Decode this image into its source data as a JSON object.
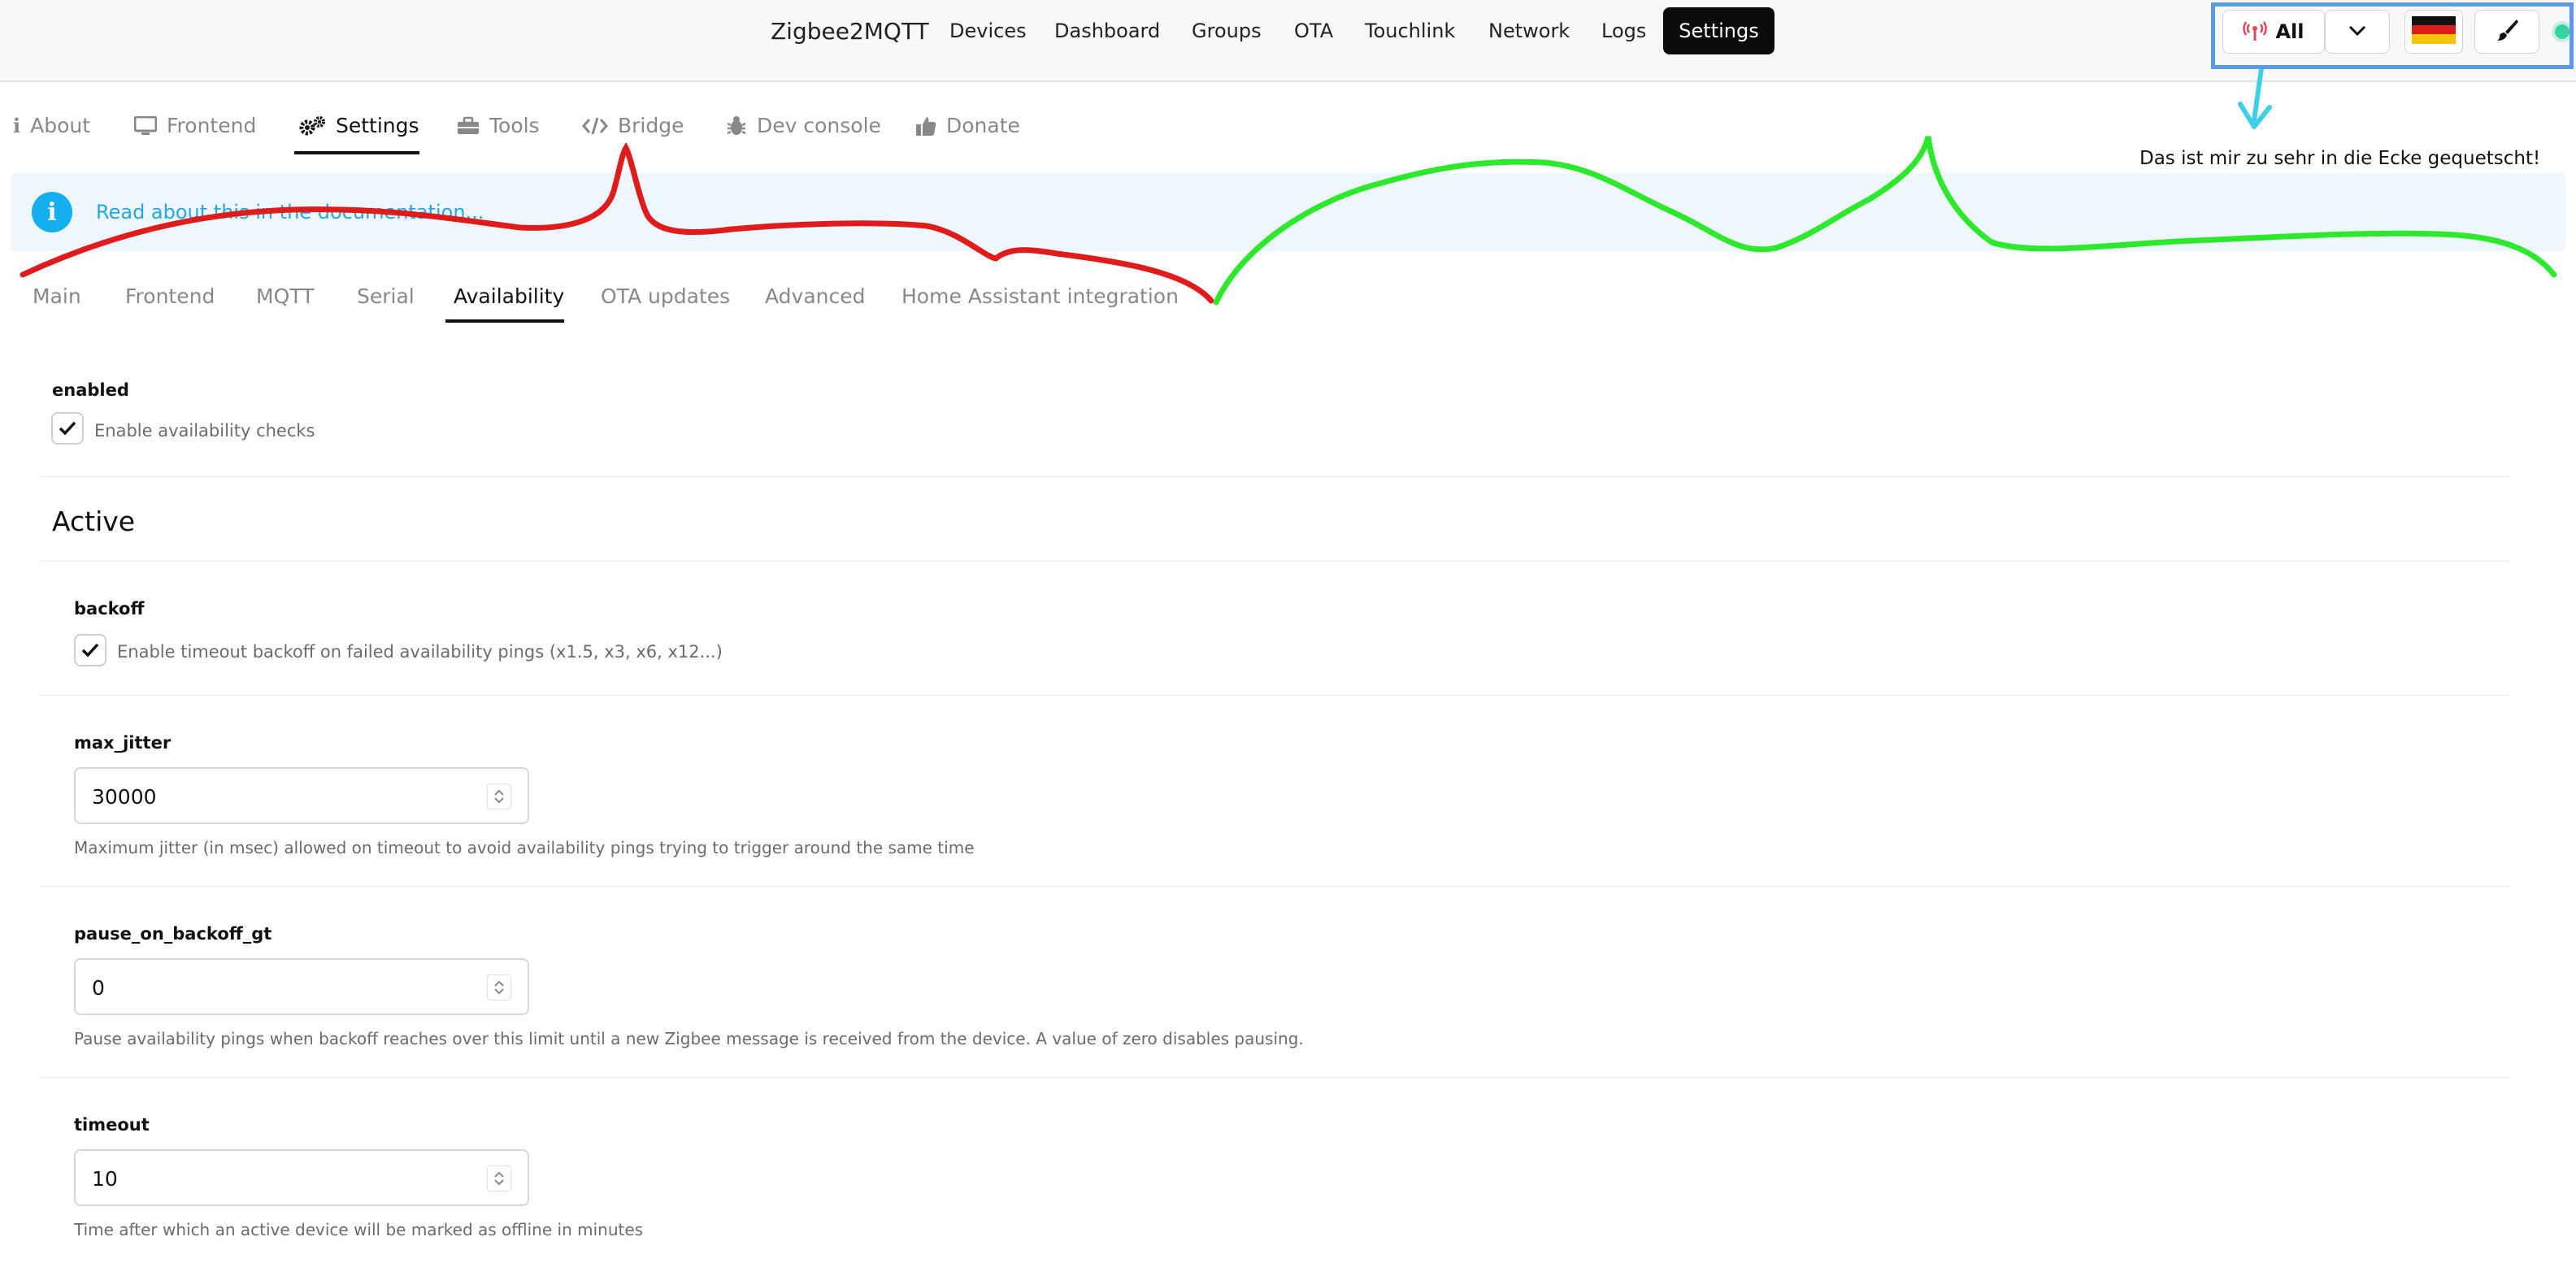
{
  "navbar": {
    "brand": "Zigbee2MQTT",
    "items": [
      "Devices",
      "Dashboard",
      "Groups",
      "OTA",
      "Touchlink",
      "Network",
      "Logs"
    ],
    "active": "Settings",
    "filter_label": "All"
  },
  "settings_tabs": [
    {
      "label": "About",
      "icon": "info-icon"
    },
    {
      "label": "Frontend",
      "icon": "monitor-icon"
    },
    {
      "label": "Settings",
      "icon": "gears-icon"
    },
    {
      "label": "Tools",
      "icon": "toolbox-icon"
    },
    {
      "label": "Bridge",
      "icon": "code-icon"
    },
    {
      "label": "Dev console",
      "icon": "bug-icon"
    },
    {
      "label": "Donate",
      "icon": "thumbs-up-icon"
    }
  ],
  "alert": {
    "icon": "i",
    "link": "Read about this in the documentation..."
  },
  "sub_tabs": [
    "Main",
    "Frontend",
    "MQTT",
    "Serial",
    "Availability",
    "OTA updates",
    "Advanced",
    "Home Assistant integration"
  ],
  "form": {
    "enabled": {
      "label": "enabled",
      "text": "Enable availability checks",
      "checked": true
    },
    "section": "Active",
    "backoff": {
      "label": "backoff",
      "text": "Enable timeout backoff on failed availability pings (x1.5, x3, x6, x12...)",
      "checked": true
    },
    "max_jitter": {
      "label": "max_jitter",
      "value": "30000",
      "help": "Maximum jitter (in msec) allowed on timeout to avoid availability pings trying to trigger around the same time"
    },
    "pause_on_backoff_gt": {
      "label": "pause_on_backoff_gt",
      "value": "0",
      "help": "Pause availability pings when backoff reaches over this limit until a new Zigbee message is received from the device. A value of zero disables pausing."
    },
    "timeout": {
      "label": "timeout",
      "value": "10",
      "help": "Time after which an active device will be marked as offline in minutes"
    }
  },
  "annotation": {
    "text": "Das ist mir zu sehr in die Ecke gequetscht!"
  },
  "colors": {
    "accent": "#0b0b0b",
    "info": "#12aef0",
    "annotation_red": "#e01b1b",
    "annotation_green": "#2ee82e",
    "annotation_cyan": "#3fd0e8",
    "annotation_box": "#5b9be6",
    "status": "#34d3a5"
  }
}
